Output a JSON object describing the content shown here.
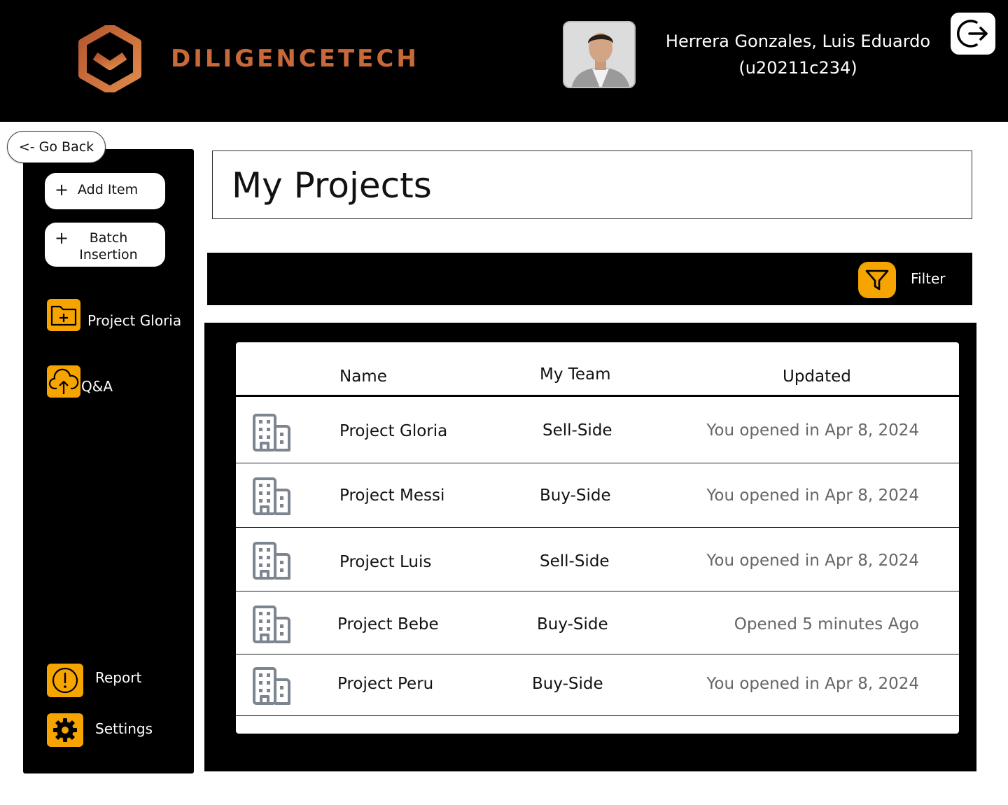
{
  "header": {
    "brand": "DILIGENCETECH",
    "user_name": "Herrera Gonzales, Luis Eduardo",
    "user_code": "(u20211c234)"
  },
  "nav": {
    "go_back": "<- Go Back"
  },
  "sidebar": {
    "add_item": "Add Item",
    "batch_line1": "Batch",
    "batch_line2": "Insertion",
    "project_link": "Project Gloria",
    "qa_link": "Q&A",
    "report": "Report",
    "settings": "Settings"
  },
  "main": {
    "title": "My Projects",
    "filter_label": "Filter",
    "columns": {
      "name": "Name",
      "team": "My Team",
      "updated": "Updated"
    },
    "rows": [
      {
        "name": "Project Gloria",
        "team": "Sell-Side",
        "updated": "You opened in Apr 8, 2024"
      },
      {
        "name": "Project Messi",
        "team": "Buy-Side",
        "updated": "You opened in Apr 8, 2024"
      },
      {
        "name": "Project Luis",
        "team": "Sell-Side",
        "updated": "You opened in Apr 8, 2024"
      },
      {
        "name": "Project Bebe",
        "team": "Buy-Side",
        "updated": "Opened 5 minutes Ago"
      },
      {
        "name": "Project Peru",
        "team": "Buy-Side",
        "updated": "You opened in Apr 8, 2024"
      }
    ]
  },
  "colors": {
    "accent": "#f5a400",
    "brand": "#c8693a",
    "background_dark": "#000000"
  },
  "icons": {
    "logo": "diligencetech-logo-icon",
    "logout": "logout-icon",
    "folder": "folder-add-icon",
    "upload": "cloud-upload-icon",
    "report": "alert-circle-icon",
    "settings": "gear-icon",
    "filter": "filter-icon",
    "project": "building-icon"
  }
}
